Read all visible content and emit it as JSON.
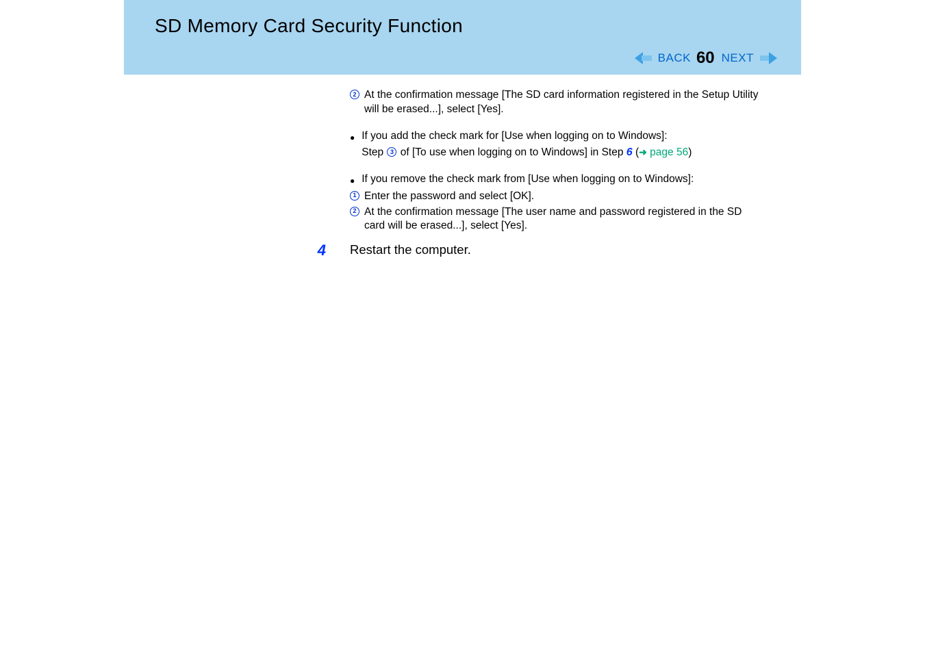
{
  "header": {
    "title": "SD Memory Card Security Function",
    "back_label": "BACK",
    "page_number": "60",
    "next_label": "NEXT"
  },
  "block1": {
    "circ_label": "2",
    "text": "At the confirmation message [The SD card information registered in the Setup Utility will be erased...], select [Yes]."
  },
  "block2": {
    "bullet_text": "If you add the check mark for [Use when logging on to Windows]:",
    "line1_prefix": "Step ",
    "inline_circ": "3",
    "line1_mid": " of [To use when logging on to Windows] in Step ",
    "step_ref": "6",
    "paren_open": " (",
    "arrow": "➜",
    "link_text": " page 56",
    "paren_close": ")"
  },
  "block3": {
    "bullet_text": "If you remove the check mark from [Use when logging on to Windows]:",
    "sub1_label": "1",
    "sub1_text": "Enter the password and select [OK].",
    "sub2_label": "2",
    "sub2_text": "At the confirmation message [The user name and password registered in the SD card will be erased...], select [Yes]."
  },
  "step4": {
    "number": "4",
    "text": "Restart the computer."
  }
}
